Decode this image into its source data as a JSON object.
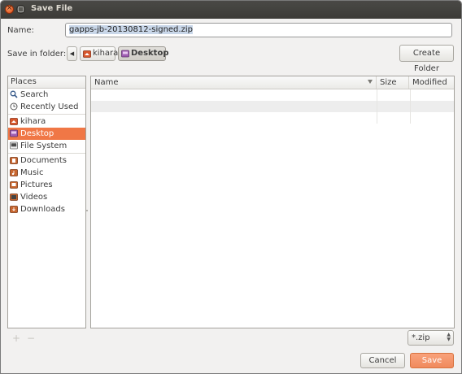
{
  "window": {
    "title": "Save File"
  },
  "form": {
    "name_label": "Name:",
    "name_value": "gapps-jb-20130812-signed.zip",
    "folder_label": "Save in folder:"
  },
  "pathbar": {
    "back_glyph": "◀",
    "crumbs": [
      {
        "label": "kihara",
        "icon": "home-folder-icon"
      },
      {
        "label": "Desktop",
        "icon": "desktop-folder-icon",
        "active": true
      }
    ]
  },
  "create_folder": "Create Folder",
  "places": {
    "header": "Places",
    "items": [
      {
        "label": "Search",
        "icon": "search-icon"
      },
      {
        "label": "Recently Used",
        "icon": "recent-icon"
      },
      {
        "label": "kihara",
        "icon": "home-folder-icon"
      },
      {
        "label": "Desktop",
        "icon": "desktop-folder-icon",
        "selected": true
      },
      {
        "label": "File System",
        "icon": "drive-icon"
      },
      {
        "label": "Documents",
        "icon": "documents-folder-icon"
      },
      {
        "label": "Music",
        "icon": "music-folder-icon"
      },
      {
        "label": "Pictures",
        "icon": "pictures-folder-icon"
      },
      {
        "label": "Videos",
        "icon": "videos-folder-icon"
      },
      {
        "label": "Downloads",
        "icon": "downloads-folder-icon"
      }
    ],
    "add_glyph": "+",
    "remove_glyph": "−"
  },
  "files": {
    "columns": {
      "name": "Name",
      "size": "Size",
      "modified": "Modified"
    },
    "rows": []
  },
  "filter": {
    "value": "*.zip"
  },
  "buttons": {
    "cancel": "Cancel",
    "save": "Save"
  },
  "colors": {
    "accent": "#f07746",
    "save_button": "#f08a5d",
    "close_button": "#dd4814"
  }
}
